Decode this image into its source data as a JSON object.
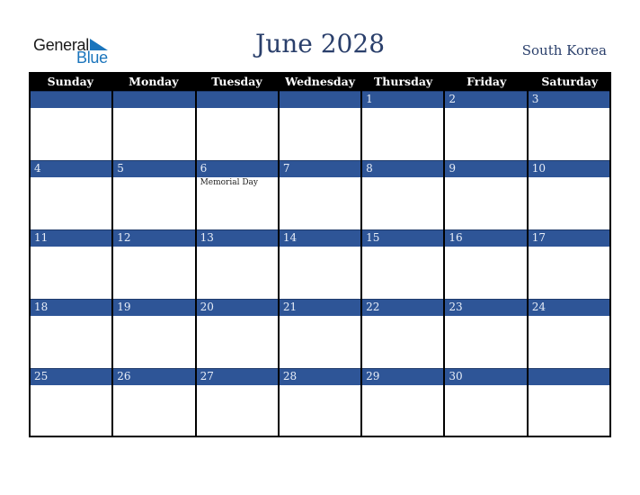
{
  "logo": {
    "general": "General",
    "blue": "Blue"
  },
  "title": "June 2028",
  "country": "South Korea",
  "colors": {
    "accent": "#2e5597",
    "header": "#000000",
    "title": "#2a3f6b",
    "logo_blue": "#1b75bc"
  },
  "weekdays": [
    "Sunday",
    "Monday",
    "Tuesday",
    "Wednesday",
    "Thursday",
    "Friday",
    "Saturday"
  ],
  "weeks": [
    [
      {
        "day": ""
      },
      {
        "day": ""
      },
      {
        "day": ""
      },
      {
        "day": ""
      },
      {
        "day": "1"
      },
      {
        "day": "2"
      },
      {
        "day": "3"
      }
    ],
    [
      {
        "day": "4"
      },
      {
        "day": "5"
      },
      {
        "day": "6",
        "event": "Memorial Day"
      },
      {
        "day": "7"
      },
      {
        "day": "8"
      },
      {
        "day": "9"
      },
      {
        "day": "10"
      }
    ],
    [
      {
        "day": "11"
      },
      {
        "day": "12"
      },
      {
        "day": "13"
      },
      {
        "day": "14"
      },
      {
        "day": "15"
      },
      {
        "day": "16"
      },
      {
        "day": "17"
      }
    ],
    [
      {
        "day": "18"
      },
      {
        "day": "19"
      },
      {
        "day": "20"
      },
      {
        "day": "21"
      },
      {
        "day": "22"
      },
      {
        "day": "23"
      },
      {
        "day": "24"
      }
    ],
    [
      {
        "day": "25"
      },
      {
        "day": "26"
      },
      {
        "day": "27"
      },
      {
        "day": "28"
      },
      {
        "day": "29"
      },
      {
        "day": "30"
      },
      {
        "day": ""
      }
    ]
  ]
}
